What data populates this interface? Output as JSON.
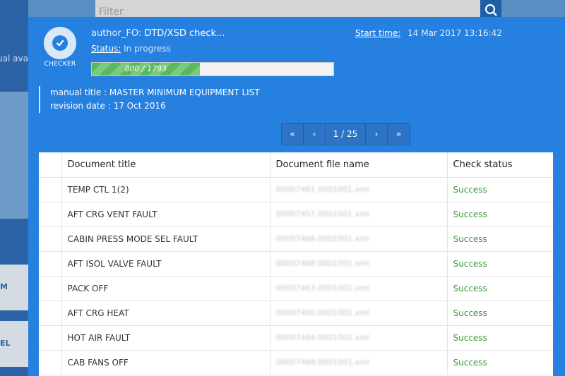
{
  "background": {
    "filter_placeholder": "Filter",
    "side_text": "ual ava",
    "side_link_1": "M",
    "side_link_2": "EL"
  },
  "dialog": {
    "checker_label": "CHECKER",
    "title_author": "author_FO:",
    "title_text": "DTD/XSD check...",
    "status_key": "Status:",
    "status_value": "In progress",
    "start_key": "Start time:",
    "start_value": "14 Mar 2017 13:16:42",
    "progress": {
      "current": 800,
      "total": 1793,
      "label": "800 / 1793"
    },
    "manual_title_line": "manual title : MASTER MINIMUM EQUIPMENT LIST",
    "revision_date_line": "revision date : 17 Oct 2016"
  },
  "pager": {
    "first": "«",
    "prev": "‹",
    "page": "1 / 25",
    "next": "›",
    "last": "»"
  },
  "table": {
    "headers": {
      "select": "",
      "title": "Document title",
      "file": "Document file name",
      "status": "Check status"
    },
    "rows": [
      {
        "title": "TEMP CTL 1(2)",
        "file": "00007461.0001001.xml",
        "status": "Success"
      },
      {
        "title": "AFT CRG VENT FAULT",
        "file": "00007457.0001001.xml",
        "status": "Success"
      },
      {
        "title": "CABIN PRESS MODE SEL FAULT",
        "file": "00007466.0001001.xml",
        "status": "Success"
      },
      {
        "title": "AFT ISOL VALVE FAULT",
        "file": "00007468.0001001.xml",
        "status": "Success"
      },
      {
        "title": "PACK OFF",
        "file": "00007463.0001001.xml",
        "status": "Success"
      },
      {
        "title": "AFT CRG HEAT",
        "file": "00007460.0001001.xml",
        "status": "Success"
      },
      {
        "title": "HOT AIR FAULT",
        "file": "00007464.0001001.xml",
        "status": "Success"
      },
      {
        "title": "CAB FANS OFF",
        "file": "00007469.0001001.xml",
        "status": "Success"
      }
    ]
  }
}
